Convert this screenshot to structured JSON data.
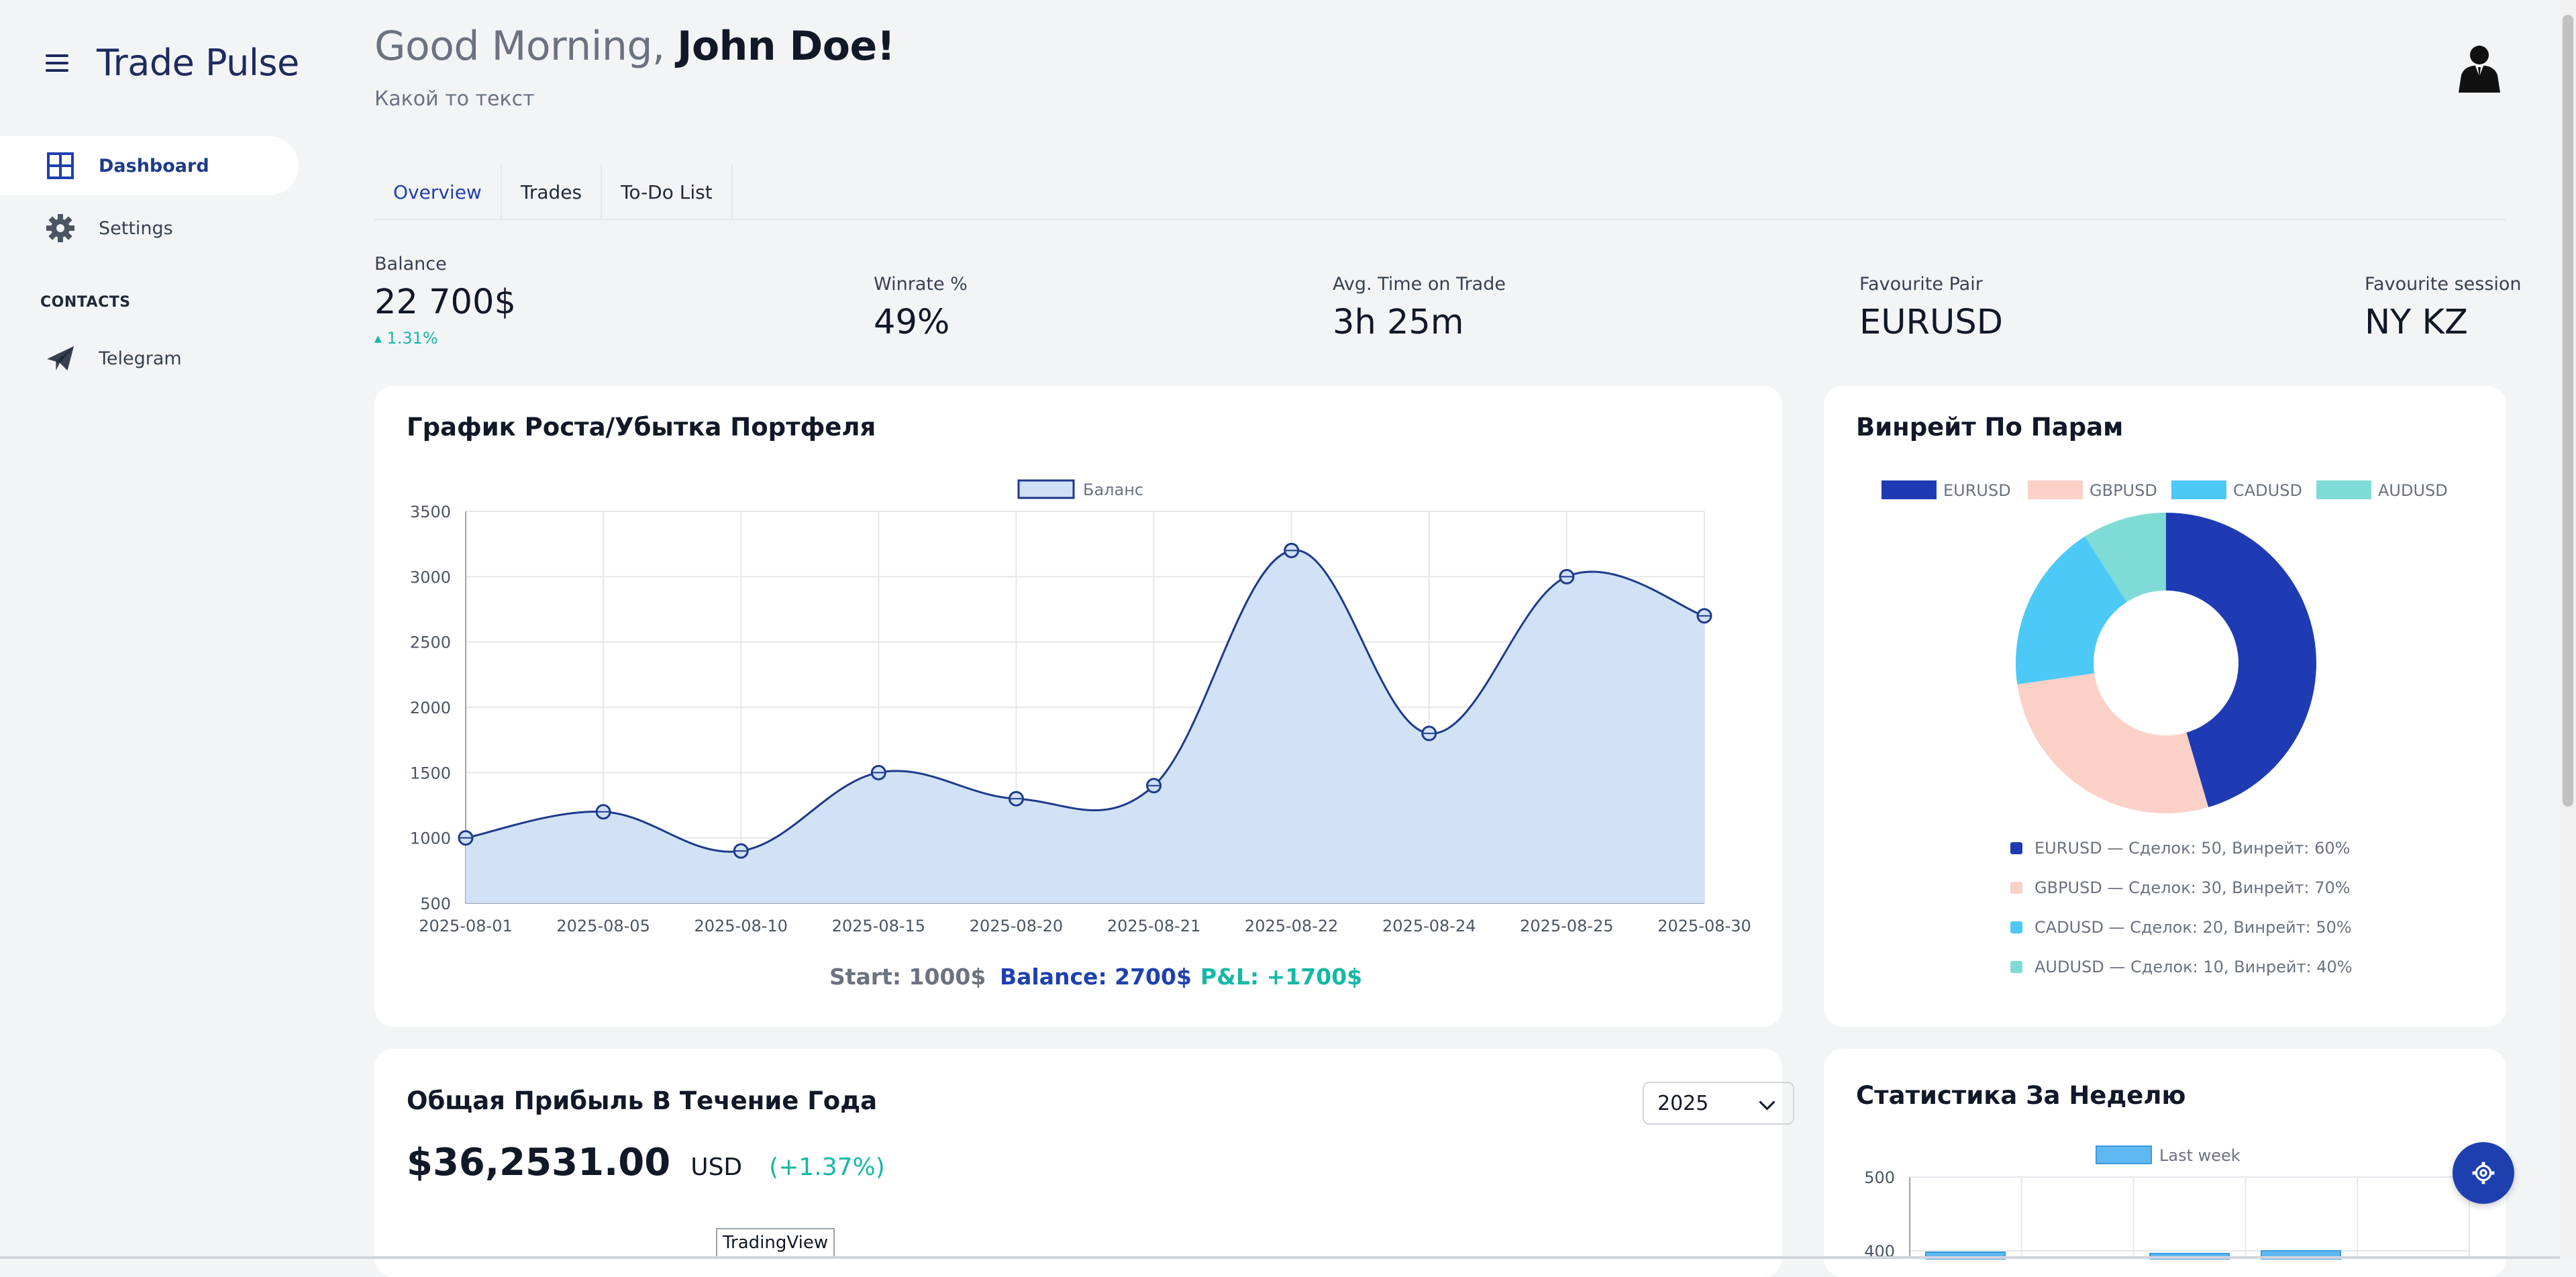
{
  "app": {
    "name": "Trade Pulse"
  },
  "sidebar": {
    "items": [
      {
        "label": "Dashboard",
        "icon": "dashboard-grid-icon"
      },
      {
        "label": "Settings",
        "icon": "gear-icon"
      }
    ],
    "contacts_title": "CONTACTS",
    "contacts": [
      {
        "label": "Telegram",
        "icon": "telegram-plane-icon"
      }
    ]
  },
  "header": {
    "greeting": "Good Morning,",
    "user_name": "John Doe!",
    "subtitle": "Какой то текст",
    "avatar_icon": "user-avatar-icon"
  },
  "tabs": [
    {
      "label": "Overview"
    },
    {
      "label": "Trades"
    },
    {
      "label": "To-Do List"
    }
  ],
  "stats": {
    "balance": {
      "label": "Balance",
      "value": "22 700$",
      "change": "1.31%"
    },
    "winrate": {
      "label": "Winrate %",
      "value": "49%"
    },
    "avg_time": {
      "label": "Avg. Time on Trade",
      "value": "3h 25m"
    },
    "fav_pair": {
      "label": "Favourite Pair",
      "value": "EURUSD"
    },
    "fav_session": {
      "label": "Favourite session",
      "value": "NY KZ"
    }
  },
  "portfolio_card": {
    "title": "График Роста/Убытка Портфеля",
    "summary_start": "Start: 1000$",
    "summary_balance": "Balance: 2700$",
    "summary_pl": "P&L: +1700$"
  },
  "winrate_card": {
    "title": "Винрейт По Парам",
    "details": [
      "EURUSD — Сделок: 50, Винрейт: 60%",
      "GBPUSD — Сделок: 30, Винрейт: 70%",
      "CADUSD — Сделок: 20, Винрейт: 50%",
      "AUDUSD — Сделок: 10, Винрейт: 40%"
    ]
  },
  "yearly_card": {
    "title": "Общая Прибыль В Течение Года",
    "year": "2025",
    "amount": "$36,2531.00",
    "currency": "USD",
    "change": "(+1.37%)",
    "tv_label": "TradingView"
  },
  "weekly_card": {
    "title": "Статистика За Неделю"
  },
  "colors": {
    "accent": "#1e40af",
    "positive": "#14b8a6",
    "line": "#1e3a8a",
    "area_fill": "#cfe0f7"
  },
  "fab_icon": "gear-icon",
  "chart_data": [
    {
      "type": "area",
      "series": [
        {
          "name": "Баланс",
          "values": [
            1000,
            1200,
            900,
            1500,
            1300,
            1400,
            3200,
            1800,
            3000,
            2700
          ]
        }
      ],
      "categories": [
        "2025-08-01",
        "2025-08-05",
        "2025-08-10",
        "2025-08-15",
        "2025-08-20",
        "2025-08-21",
        "2025-08-22",
        "2025-08-24",
        "2025-08-25",
        "2025-08-30"
      ],
      "yticks": [
        500,
        1000,
        1500,
        2000,
        2500,
        3000,
        3500
      ],
      "ylim": [
        500,
        3500
      ],
      "grid": true,
      "legend": "top-center"
    },
    {
      "type": "pie",
      "labels": [
        "EURUSD",
        "GBPUSD",
        "CADUSD",
        "AUDUSD"
      ],
      "values": [
        50,
        30,
        20,
        10
      ],
      "colors": [
        "#1e3bb3",
        "#fbd0c7",
        "#4cc9f7",
        "#7fdbd6"
      ],
      "legend": "top"
    },
    {
      "type": "bar",
      "series": [
        {
          "name": "Last week",
          "values": []
        }
      ],
      "yticks": [
        400,
        500
      ],
      "legend": "top-center"
    }
  ]
}
